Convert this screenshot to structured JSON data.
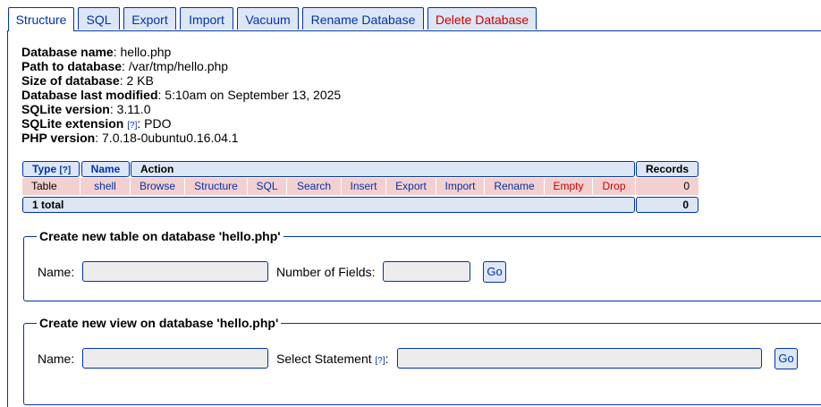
{
  "tabs": [
    {
      "label": "Structure"
    },
    {
      "label": "SQL"
    },
    {
      "label": "Export"
    },
    {
      "label": "Import"
    },
    {
      "label": "Vacuum"
    },
    {
      "label": "Rename Database"
    },
    {
      "label": "Delete Database"
    }
  ],
  "info": {
    "db_name_label": "Database name",
    "db_name": "hello.php",
    "path_label": "Path to database",
    "path": "/var/tmp/hello.php",
    "size_label": "Size of database",
    "size": "2 KB",
    "modified_label": "Database last modified",
    "modified": "5:10am on September 13, 2025",
    "sqlite_version_label": "SQLite version",
    "sqlite_version": "3.11.0",
    "sqlite_ext_label": "SQLite extension",
    "help": "[?]",
    "sqlite_ext": "PDO",
    "php_version_label": "PHP version",
    "php_version": "7.0.18-0ubuntu0.16.04.1"
  },
  "table": {
    "headers": {
      "type": "Type",
      "name": "Name",
      "action": "Action",
      "records": "Records"
    },
    "row": {
      "type": "Table",
      "name": "shell",
      "actions": [
        "Browse",
        "Structure",
        "SQL",
        "Search",
        "Insert",
        "Export",
        "Import",
        "Rename",
        "Empty",
        "Drop"
      ],
      "records": "0"
    },
    "footer": {
      "total": "1 total",
      "records": "0"
    }
  },
  "create_table": {
    "legend": "Create new table on database 'hello.php'",
    "name_label": "Name:",
    "fields_label": "Number of Fields:",
    "go": "Go",
    "name_value": "",
    "fields_value": ""
  },
  "create_view": {
    "legend": "Create new view on database 'hello.php'",
    "name_label": "Name:",
    "select_label": "Select Statement",
    "help": "[?]",
    "colon": ":",
    "go": "Go",
    "name_value": "",
    "select_value": ""
  }
}
